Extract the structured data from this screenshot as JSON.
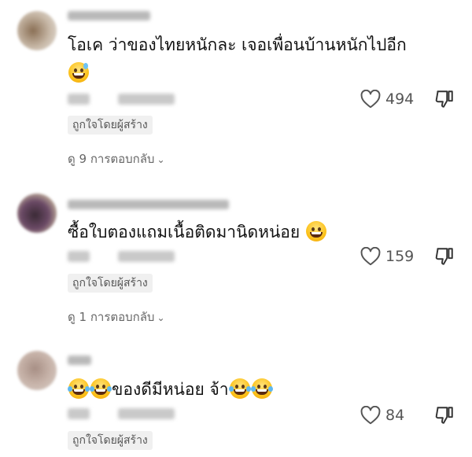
{
  "comments": [
    {
      "username": "",
      "text": "โอเค ว่าของไทยหนักละ เจอเพื่อนบ้านหนักไปอีก",
      "liked_by_creator": "ถูกใจโดยผู้สร้าง",
      "likes": "494",
      "replies_label": "ดู 9 การตอบกลับ",
      "emoji": "sweat-smile-emoji"
    },
    {
      "username": "",
      "text": "ซื้อใบตองแถมเนื้อติดมานิดหน่อย",
      "liked_by_creator": "ถูกใจโดยผู้สร้าง",
      "likes": "159",
      "replies_label": "ดู 1 การตอบกลับ",
      "emoji": "grin-emoji"
    },
    {
      "username": "",
      "text_mid": "ของดีมีหน่อย จ้า",
      "liked_by_creator": "ถูกใจโดยผู้สร้าง",
      "likes": "84",
      "emoji": "tears-of-joy-emoji"
    }
  ],
  "icons": {
    "like": "heart-outline-icon",
    "dislike": "thumbs-down-icon",
    "expand": "chevron-down-icon"
  },
  "colors": {
    "text": "#111111",
    "secondary": "#666666",
    "badge_bg": "#f0f0f0"
  }
}
